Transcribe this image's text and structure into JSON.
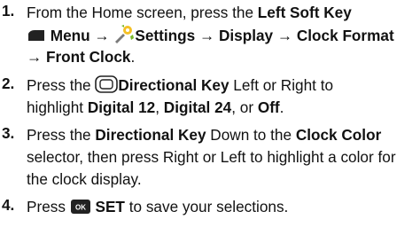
{
  "steps": [
    {
      "number": "1.",
      "l1_a": "From the Home screen, press the ",
      "l1_b": "Left Soft Key",
      "l2_a": "Menu",
      "l2_b": " → ",
      "l2_c": "Settings",
      "l2_d": " → ",
      "l2_e": "Display",
      "l2_f": " → ",
      "l2_g": "Clock Format",
      "l3_a": "→ Front Clock",
      "l3_b": "."
    },
    {
      "number": "2.",
      "l1_a": "Press the ",
      "l1_b": "Directional Key",
      "l1_c": " Left or Right to",
      "l2_a": "highlight ",
      "l2_b": "Digital 12",
      "l2_c": ", ",
      "l2_d": "Digital 24",
      "l2_e": ", or ",
      "l2_f": "Off",
      "l2_g": "."
    },
    {
      "number": "3.",
      "l1_a": "Press the ",
      "l1_b": "Directional Key",
      "l1_c": " Down to the ",
      "l1_d": "Clock Color",
      "l2": "selector, then press Right or Left to highlight a color for",
      "l3": "the clock display."
    },
    {
      "number": "4.",
      "l1_a": "Press ",
      "ok_label": "OK",
      "l1_b": "SET",
      "l1_c": " to save your selections."
    }
  ]
}
